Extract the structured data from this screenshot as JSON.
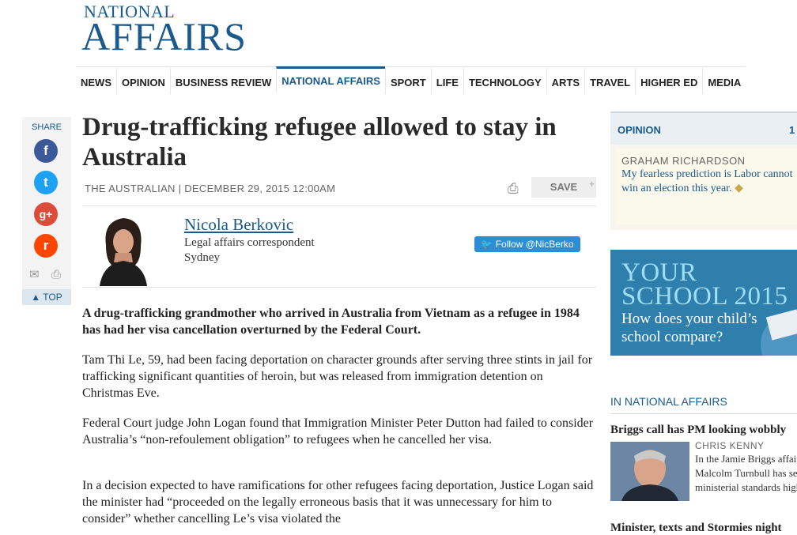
{
  "masthead": {
    "line1": "NATIONAL",
    "line2": "AFFAIRS"
  },
  "nav": [
    "NEWS",
    "OPINION",
    "BUSINESS REVIEW",
    "NATIONAL AFFAIRS",
    "SPORT",
    "LIFE",
    "TECHNOLOGY",
    "ARTS",
    "TRAVEL",
    "HIGHER ED",
    "MEDIA"
  ],
  "nav_active": "NATIONAL AFFAIRS",
  "share": {
    "label": "SHARE",
    "facebook": "f",
    "twitter": "t",
    "googleplus": "g+",
    "reddit": "r",
    "top": "TOP"
  },
  "article": {
    "headline": "Drug-trafficking refugee allowed to stay in Australia",
    "source": "THE AUSTRALIAN | DECEMBER 29, 2015 12:00AM",
    "save": "SAVE",
    "author": {
      "name": "Nicola Berkovic",
      "role": "Legal affairs correspondent",
      "location": "Sydney",
      "follow": "Follow @NicBerko"
    },
    "paragraphs": [
      "A drug-trafficking grandmother who arrived in Australia from Vietnam as a refugee in 1984 has had her visa cancellation overturned by the Federal Court.",
      "Tam Thi Le, 59, had been facing deportation on character grounds after serving three stints in jail for trafficking significant quantities of heroin, but was released from immigration detention on Christmas Eve.",
      "Federal Court judge John Logan found that Immigration Minister Peter Dutton had failed to consider Australia’s “non-refoulement obligation” to refugees when he cancelled her visa.",
      "In a decision expected to have ramifications for other refugees facing deportation, Justice Logan said the minister had “proceeded on the legally erroneous basis that it was unnecessary for him to consider” whether cancelling Le’s visa violated the"
    ]
  },
  "sidebar": {
    "opinion_label": "OPINION",
    "opinion_page": "1",
    "opinion_author": "GRAHAM RICHARDSON",
    "opinion_text": "My fearless prediction is Labor cannot win an election this year.",
    "promo_line1": "YOUR",
    "promo_line2": "SCHOOL 2015",
    "promo_text": "How does your child’s school compare?",
    "section_label": "IN NATIONAL AFFAIRS",
    "story1_head": "Briggs call has PM looking wobbly",
    "story1_author": "CHRIS KENNY",
    "story1_text": "In the Jamie Briggs affair, Malcolm Turnbull has set ministerial standards high.",
    "story2_head": "Minister, texts and Stormies night"
  },
  "colors": {
    "brand": "#1a5a8c",
    "facebook": "#3b5998",
    "twitter": "#1da1f2",
    "googleplus": "#dd4b39",
    "reddit": "#ff4500"
  },
  "icons": [
    "facebook-icon",
    "twitter-icon",
    "googleplus-icon",
    "reddit-icon",
    "email-icon",
    "print-icon",
    "chevron-up-icon",
    "tag-icon"
  ]
}
